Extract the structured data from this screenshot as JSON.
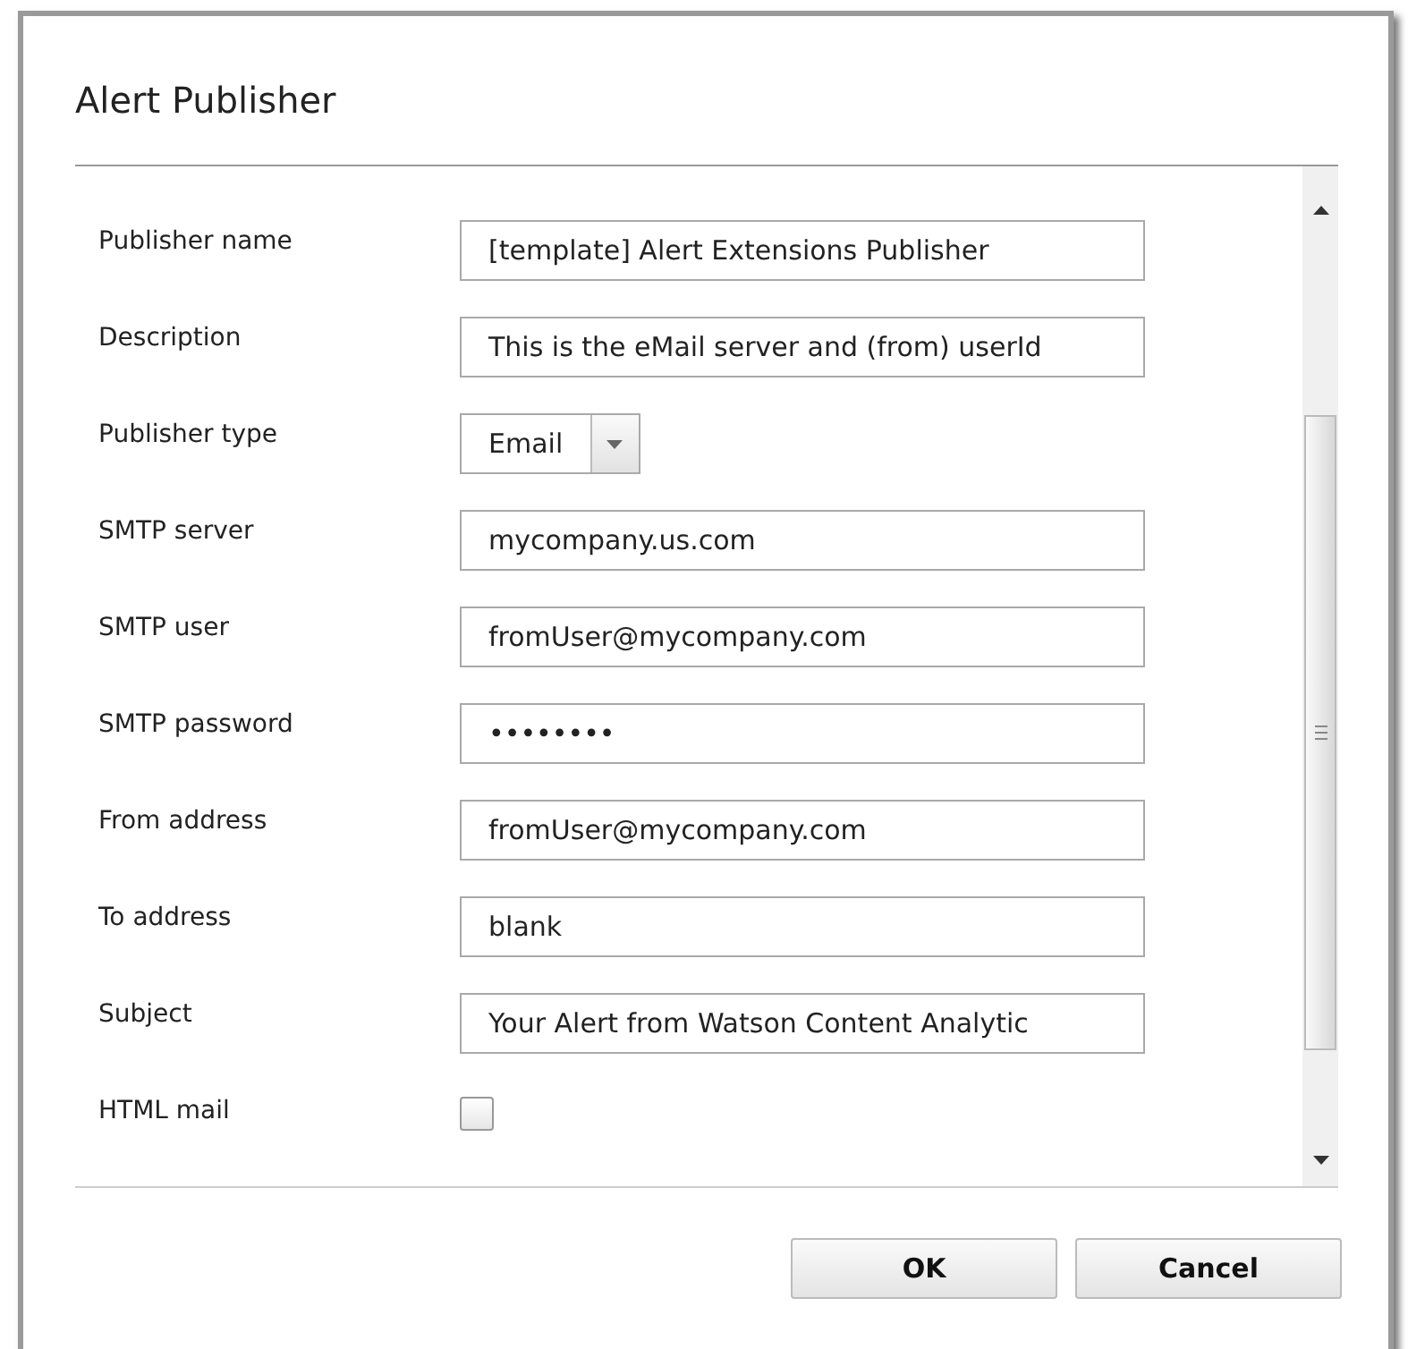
{
  "dialog": {
    "title": "Alert Publisher",
    "fields": [
      {
        "kind": "text",
        "label": "Publisher name",
        "value": "[template] Alert Extensions Publisher"
      },
      {
        "kind": "text",
        "label": "Description",
        "value": "This is the eMail server and (from) userId"
      },
      {
        "kind": "select",
        "label": "Publisher type",
        "value": "Email"
      },
      {
        "kind": "text",
        "label": "SMTP server",
        "value": "mycompany.us.com"
      },
      {
        "kind": "text",
        "label": "SMTP user",
        "value": "fromUser@mycompany.com"
      },
      {
        "kind": "text",
        "label": "SMTP password",
        "value": "••••••••"
      },
      {
        "kind": "text",
        "label": "From address",
        "value": "fromUser@mycompany.com"
      },
      {
        "kind": "text",
        "label": "To address",
        "value": "blank"
      },
      {
        "kind": "text",
        "label": "Subject",
        "value": "Your Alert from Watson Content Analytic"
      },
      {
        "kind": "checkbox",
        "label": "HTML mail",
        "checked": false
      }
    ],
    "buttons": [
      "OK",
      "Cancel"
    ]
  }
}
